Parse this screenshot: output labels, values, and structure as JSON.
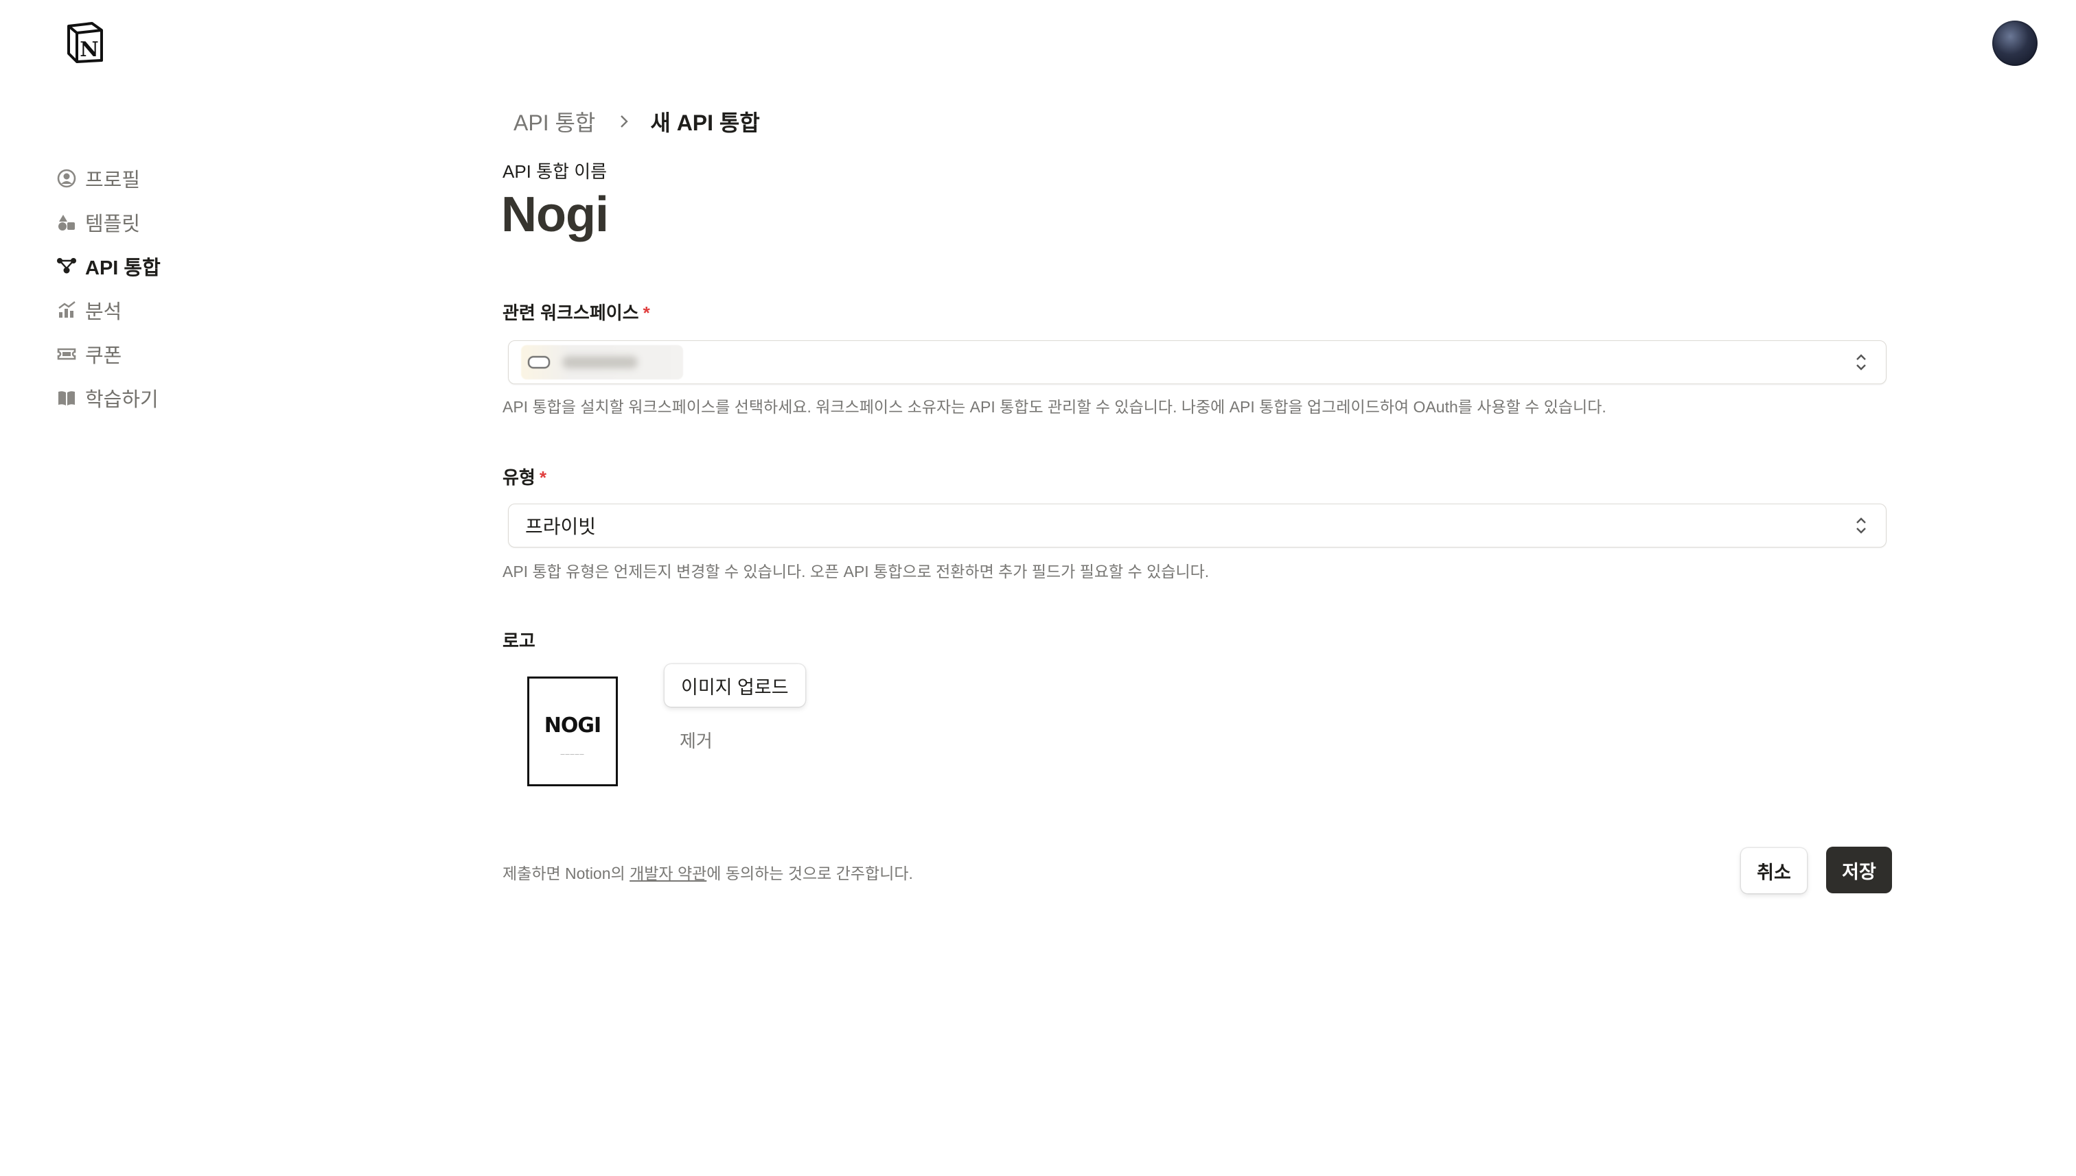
{
  "app": {
    "logo_icon": "notion-logo-icon",
    "avatar_icon": "user-avatar"
  },
  "sidebar": {
    "items": [
      {
        "label": "프로필",
        "icon": "profile-icon"
      },
      {
        "label": "템플릿",
        "icon": "templates-icon"
      },
      {
        "label": "API 통합",
        "icon": "integrations-icon",
        "active": true
      },
      {
        "label": "분석",
        "icon": "analytics-icon"
      },
      {
        "label": "쿠폰",
        "icon": "coupon-icon"
      },
      {
        "label": "학습하기",
        "icon": "book-icon"
      }
    ]
  },
  "breadcrumb": {
    "parent": "API 통합",
    "current": "새 API 통합"
  },
  "form": {
    "name_label": "API 통합 이름",
    "name_value": "Nogi",
    "workspace": {
      "label": "관련 워크스페이스",
      "required_mark": "*",
      "help": "API 통합을 설치할 워크스페이스를 선택하세요. 워크스페이스 소유자는 API 통합도 관리할 수 있습니다. 나중에 API 통합을 업그레이드하여 OAuth를 사용할 수 있습니다."
    },
    "type": {
      "label": "유형",
      "required_mark": "*",
      "value": "프라이빗",
      "help": "API 통합 유형은 언제든지 변경할 수 있습니다. 오픈 API 통합으로 전환하면 추가 필드가 필요할 수 있습니다."
    },
    "logo": {
      "label": "로고",
      "image_text": "NOGI",
      "upload_label": "이미지 업로드",
      "remove_label": "제거"
    }
  },
  "footer": {
    "terms_prefix": "제출하면 Notion의 ",
    "terms_link": "개발자 약관",
    "terms_suffix": "에 동의하는 것으로 간주합니다.",
    "cancel_label": "취소",
    "save_label": "저장"
  },
  "colors": {
    "save_button_bg": "#2f2e2b",
    "required": "#e03e3e"
  }
}
